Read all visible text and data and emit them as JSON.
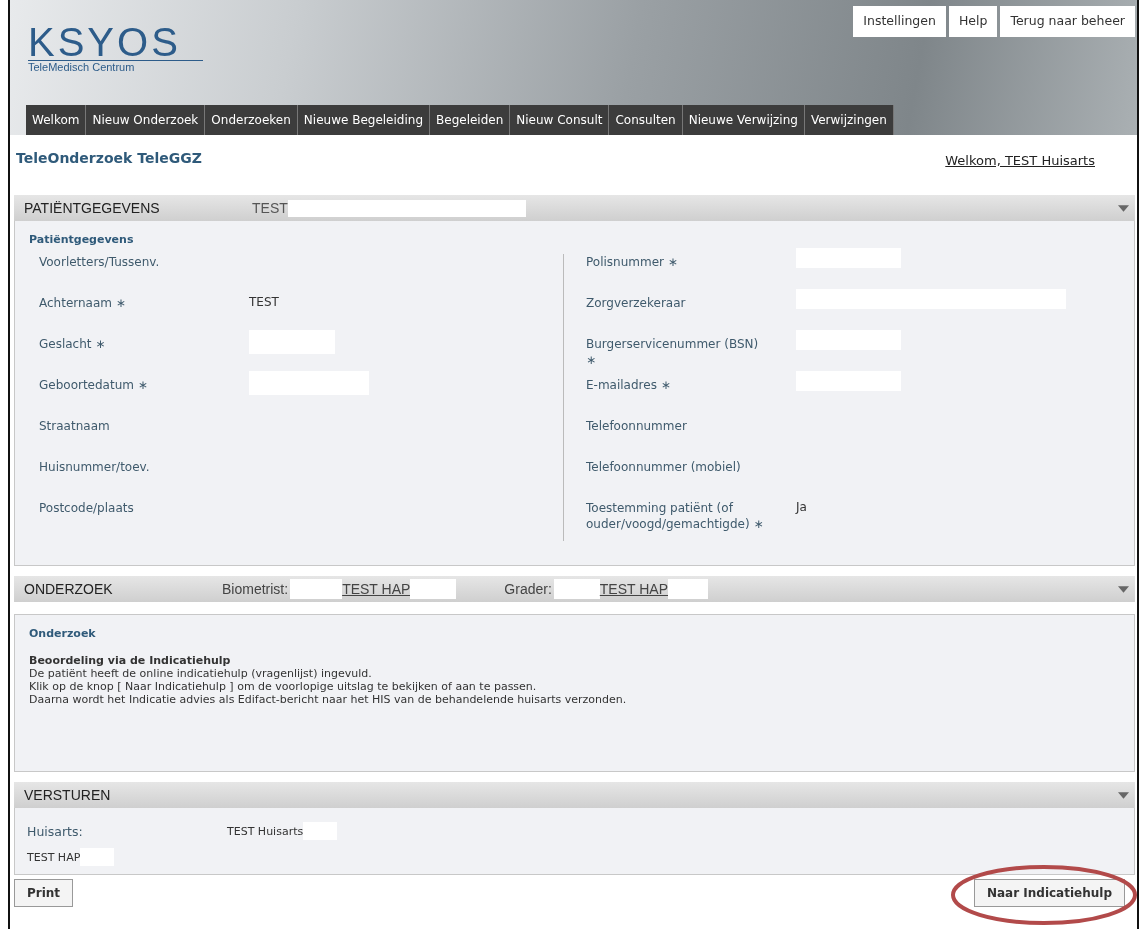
{
  "header": {
    "logo": {
      "name": "KSYOS",
      "subtitle": "TeleMedisch Centrum"
    },
    "top_links": [
      "Instellingen",
      "Help",
      "Terug naar beheer"
    ],
    "nav_tabs": [
      "Welkom",
      "Nieuw Onderzoek",
      "Onderzoeken",
      "Nieuwe Begeleiding",
      "Begeleiden",
      "Nieuw Consult",
      "Consulten",
      "Nieuwe Verwijzing",
      "Verwijzingen"
    ]
  },
  "page_title": "TeleOnderzoek TeleGGZ",
  "welcome_link": "Welkom, TEST Huisarts",
  "patient_section": {
    "title": "PATIËNTGEGEVENS",
    "patient_name": "TEST",
    "subheading": "Patiëntgegevens",
    "left_fields": [
      {
        "label": "Voorletters/Tussenv."
      },
      {
        "label": "Achternaam ∗",
        "value": "TEST"
      },
      {
        "label": "Geslacht ∗",
        "redacted": true
      },
      {
        "label": "Geboortedatum ∗",
        "redacted": true
      },
      {
        "label": "Straatnaam"
      },
      {
        "label": "Huisnummer/toev."
      },
      {
        "label": "Postcode/plaats"
      }
    ],
    "right_fields": [
      {
        "label": "Polisnummer ∗",
        "redacted": true
      },
      {
        "label": "Zorgverzekeraar",
        "redacted": true
      },
      {
        "label": "Burgerservicenummer (BSN) ∗",
        "redacted": true
      },
      {
        "label": "E-mailadres ∗",
        "redacted": true
      },
      {
        "label": "Telefoonnummer"
      },
      {
        "label": "Telefoonnummer (mobiel)"
      },
      {
        "label": "Toestemming patiënt (of ouder/voogd/gemachtigde) ∗",
        "value": "Ja"
      }
    ]
  },
  "onderzoek_section": {
    "title": "ONDERZOEK",
    "biometrist_label": "Biometrist:",
    "biometrist": "TEST HAP",
    "grader_label": "Grader:",
    "grader": "TEST HAP",
    "subheading": "Onderzoek",
    "heading": "Beoordeling via de Indicatiehulp",
    "lines": [
      "De patiënt heeft de online indicatiehulp (vragenlijst) ingevuld.",
      "Klik op de knop [ Naar Indicatiehulp ] om de voorlopige uitslag te bekijken of aan te passen.",
      "Daarna wordt het Indicatie advies als Edifact-bericht naar het HIS van de behandelende huisarts verzonden."
    ]
  },
  "versturen_section": {
    "title": "VERSTUREN",
    "huisarts_label": "Huisarts:",
    "huisarts": "TEST Huisarts",
    "hap": "TEST HAP"
  },
  "buttons": {
    "print": "Print",
    "next": "Naar Indicatiehulp"
  }
}
